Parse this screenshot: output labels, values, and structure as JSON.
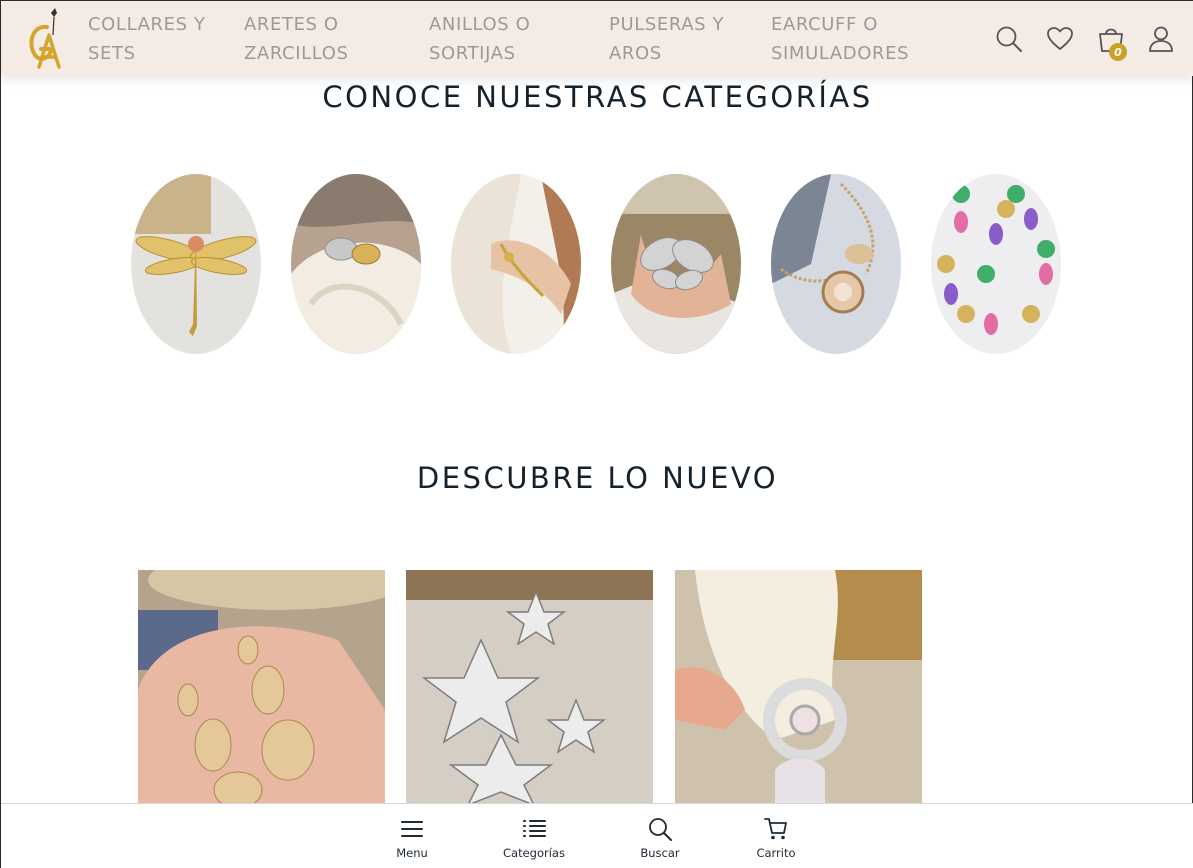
{
  "header": {
    "logo_text": "GA",
    "nav": [
      {
        "line1": "COLLARES Y",
        "line2": "SETS"
      },
      {
        "line1": "ARETES O",
        "line2": "ZARCILLOS"
      },
      {
        "line1": "ANILLOS O",
        "line2": "SORTIJAS"
      },
      {
        "line1": "PULSERAS Y",
        "line2": "AROS"
      },
      {
        "line1": "EARCUFF O",
        "line2": "SIMULADORES"
      }
    ],
    "cart_count": "0",
    "icons": [
      "search-icon",
      "heart-icon",
      "bag-icon",
      "user-icon"
    ]
  },
  "categories_section": {
    "title": "CONOCE NUESTRAS CATEGORÍAS",
    "items": [
      {
        "image": "gold-dragonfly-brooch"
      },
      {
        "image": "silver-gold-ring-on-ear-model"
      },
      {
        "image": "gold-bracelet-on-wrist"
      },
      {
        "image": "silver-butterfly-ring"
      },
      {
        "image": "rose-gold-necklace"
      },
      {
        "image": "colorful-drop-earrings-card"
      }
    ]
  },
  "new_section": {
    "title": "DESCUBRE LO NUEVO",
    "products": [
      {
        "image": "gold-leaf-drop-earrings"
      },
      {
        "image": "silver-star-earrings"
      },
      {
        "image": "silver-half-moon-earcuff"
      }
    ]
  },
  "bottom_nav": [
    {
      "label": "Menu",
      "icon": "menu-icon"
    },
    {
      "label": "Categorías",
      "icon": "list-icon"
    },
    {
      "label": "Buscar",
      "icon": "search-icon"
    },
    {
      "label": "Carrito",
      "icon": "cart-icon"
    }
  ],
  "colors": {
    "header_bg": "#f5ebe5",
    "nav_text": "#9a9a9a",
    "heading": "#15212b",
    "accent_gold": "#c9a227"
  }
}
